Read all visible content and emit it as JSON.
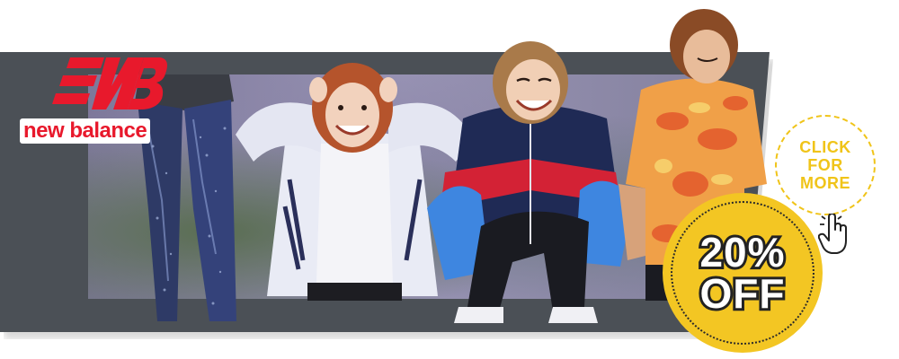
{
  "brand": {
    "name": "new balance",
    "color": "#e8192c"
  },
  "promo": {
    "cta_lines": [
      "CLICK",
      "FOR",
      "MORE"
    ],
    "discount_lines": [
      "20%",
      "OFF"
    ],
    "cta_color": "#f0c419",
    "badge_color": "#f3c623"
  },
  "icons": {
    "logo": "new-balance-nb-logo",
    "cursor": "hand-pointer-icon"
  },
  "theme": {
    "panel": "#4b5056",
    "backdrop": "#8b86a8"
  }
}
